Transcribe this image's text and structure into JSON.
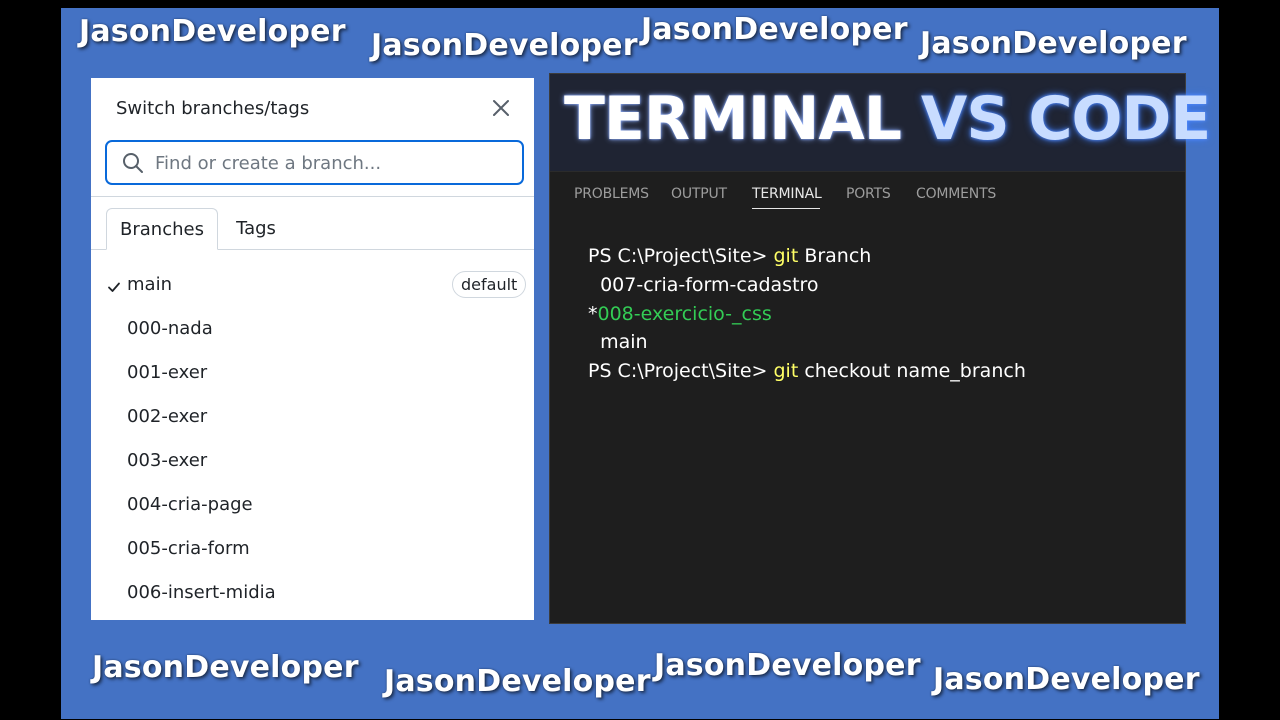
{
  "watermark_text": "JasonDeveloper",
  "panel": {
    "title": "Switch branches/tags",
    "search_placeholder": "Find or create a branch...",
    "tabs": [
      "Branches",
      "Tags"
    ],
    "branches": [
      "main",
      "000-nada",
      "001-exer",
      "002-exer",
      "003-exer",
      "004-cria-page",
      "005-cria-form",
      "006-insert-midia"
    ],
    "default_badge": "default"
  },
  "terminal": {
    "title_part1": "TERMINAL",
    "title_part2": "VS CODE",
    "panel_tabs": [
      "PROBLEMS",
      "OUTPUT",
      "TERMINAL",
      "PORTS",
      "COMMENTS"
    ],
    "lines": {
      "l1_prompt": "PS C:\\Project\\Site> ",
      "l1_git": "git",
      "l1_rest": " Branch",
      "l2": "  007-cria-form-cadastro",
      "l3_star": "*",
      "l3_branch": "008-exercicio-_css",
      "l4": "  main",
      "l5_prompt": "PS C:\\Project\\Site> ",
      "l5_git": "git",
      "l5_rest": " checkout name_branch"
    }
  },
  "colors": {
    "background": "#4472c4",
    "accent": "#0969da",
    "terminal_keyword": "#ffff66",
    "terminal_branch": "#33cc55"
  }
}
